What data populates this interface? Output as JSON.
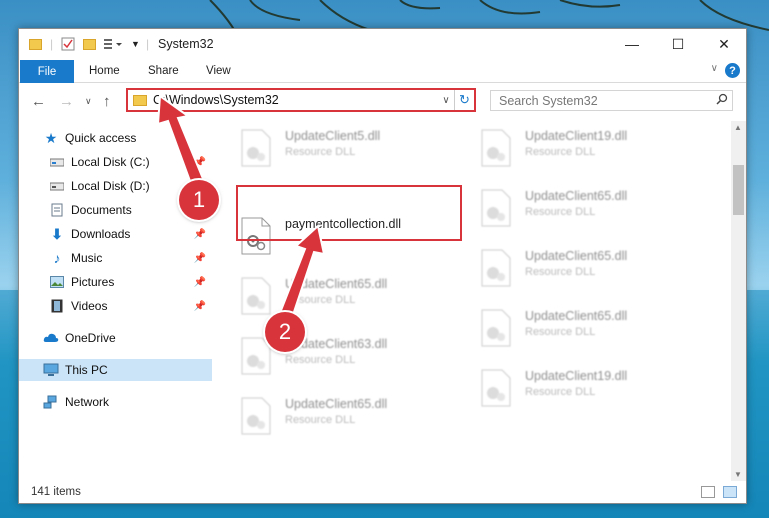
{
  "window": {
    "title": "System32",
    "controls": {
      "minimize": "—",
      "maximize": "☐",
      "close": "✕"
    }
  },
  "ribbon": {
    "file_tab": "File",
    "tabs": [
      "Home",
      "Share",
      "View"
    ],
    "help": "?"
  },
  "navigation": {
    "address": "C:\\Windows\\System32",
    "search_placeholder": "Search System32"
  },
  "sidebar": {
    "items": [
      {
        "label": "Quick access",
        "icon": "star-icon"
      },
      {
        "label": "Local Disk (C:)",
        "icon": "drive-icon",
        "pinned": true
      },
      {
        "label": "Local Disk (D:)",
        "icon": "drive-icon"
      },
      {
        "label": "Documents",
        "icon": "documents-icon",
        "pinned": true
      },
      {
        "label": "Downloads",
        "icon": "download-icon",
        "pinned": true
      },
      {
        "label": "Music",
        "icon": "music-icon",
        "pinned": true
      },
      {
        "label": "Pictures",
        "icon": "pictures-icon",
        "pinned": true
      },
      {
        "label": "Videos",
        "icon": "videos-icon",
        "pinned": true
      },
      {
        "label": "OneDrive",
        "icon": "cloud-icon"
      },
      {
        "label": "This PC",
        "icon": "computer-icon",
        "selected": true
      },
      {
        "label": "Network",
        "icon": "network-icon"
      }
    ]
  },
  "files": {
    "col1": [
      {
        "name": "UpdateClient5.dll",
        "type": "Resource DLL"
      },
      {
        "name": "paymentcollection.dll",
        "type": ""
      },
      {
        "name": "UpdateClient65.dll",
        "type": "Resource DLL"
      },
      {
        "name": "UpdateClient63.dll",
        "type": "Resource DLL"
      },
      {
        "name": "UpdateClient65.dll",
        "type": "Resource DLL"
      }
    ],
    "col2": [
      {
        "name": "UpdateClient19.dll",
        "type": "Resource DLL"
      },
      {
        "name": "UpdateClient65.dll",
        "type": "Resource DLL"
      },
      {
        "name": "UpdateClient65.dll",
        "type": "Resource DLL"
      },
      {
        "name": "UpdateClient65.dll",
        "type": "Resource DLL"
      },
      {
        "name": "UpdateClient19.dll",
        "type": "Resource DLL"
      }
    ]
  },
  "status": {
    "count": "141 items"
  },
  "annotations": {
    "step1": "1",
    "step2": "2"
  },
  "colors": {
    "accent": "#1979ca",
    "highlight": "#d8343c"
  }
}
